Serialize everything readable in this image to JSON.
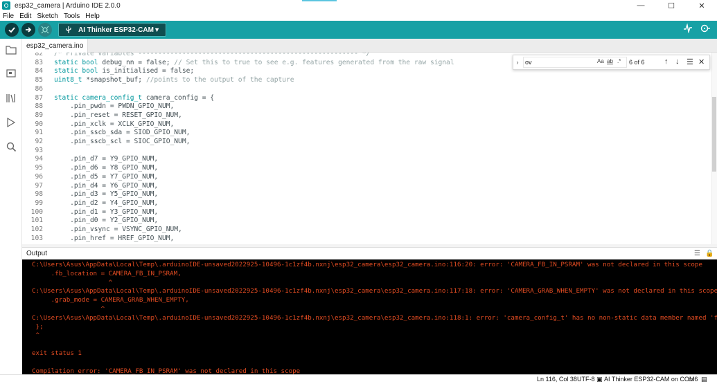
{
  "window": {
    "title": "esp32_camera | Arduino IDE 2.0.0",
    "controls": {
      "minimize": "—",
      "maximize": "☐",
      "close": "✕"
    }
  },
  "menu": [
    "File",
    "Edit",
    "Sketch",
    "Tools",
    "Help"
  ],
  "toolbar": {
    "board_label": "AI Thinker ESP32-CAM"
  },
  "tabs": [
    {
      "label": "esp32_camera.ino"
    }
  ],
  "editor": {
    "lines": [
      {
        "n": "82",
        "parts": [
          {
            "t": "/* Private variables ------------------------------------------------------- */",
            "c": "cm"
          }
        ]
      },
      {
        "n": "83",
        "parts": [
          {
            "t": "static bool",
            "c": "kw"
          },
          {
            "t": " debug_nn = false; ",
            "c": ""
          },
          {
            "t": "// Set this to true to see e.g. features generated from the raw signal",
            "c": "cm"
          }
        ]
      },
      {
        "n": "84",
        "parts": [
          {
            "t": "static bool",
            "c": "kw"
          },
          {
            "t": " is_initialised = false;",
            "c": ""
          }
        ]
      },
      {
        "n": "85",
        "parts": [
          {
            "t": "uint8_t",
            "c": "kw"
          },
          {
            "t": " *snapshot_buf; ",
            "c": ""
          },
          {
            "t": "//points to the output of the capture",
            "c": "cm"
          }
        ]
      },
      {
        "n": "86",
        "parts": []
      },
      {
        "n": "87",
        "parts": [
          {
            "t": "static camera_config_t",
            "c": "kw"
          },
          {
            "t": " camera_config = {",
            "c": ""
          }
        ]
      },
      {
        "n": "88",
        "parts": [
          {
            "t": "    .pin_pwdn = PWDN_GPIO_NUM,",
            "c": ""
          }
        ]
      },
      {
        "n": "89",
        "parts": [
          {
            "t": "    .pin_reset = RESET_GPIO_NUM,",
            "c": ""
          }
        ]
      },
      {
        "n": "90",
        "parts": [
          {
            "t": "    .pin_xclk = XCLK_GPIO_NUM,",
            "c": ""
          }
        ]
      },
      {
        "n": "91",
        "parts": [
          {
            "t": "    .pin_sscb_sda = SIOD_GPIO_NUM,",
            "c": ""
          }
        ]
      },
      {
        "n": "92",
        "parts": [
          {
            "t": "    .pin_sscb_scl = SIOC_GPIO_NUM,",
            "c": ""
          }
        ]
      },
      {
        "n": "93",
        "parts": []
      },
      {
        "n": "94",
        "parts": [
          {
            "t": "    .pin_d7 = Y9_GPIO_NUM,",
            "c": ""
          }
        ]
      },
      {
        "n": "95",
        "parts": [
          {
            "t": "    .pin_d6 = Y8_GPIO_NUM,",
            "c": ""
          }
        ]
      },
      {
        "n": "96",
        "parts": [
          {
            "t": "    .pin_d5 = Y7_GPIO_NUM,",
            "c": ""
          }
        ]
      },
      {
        "n": "97",
        "parts": [
          {
            "t": "    .pin_d4 = Y6_GPIO_NUM,",
            "c": ""
          }
        ]
      },
      {
        "n": "98",
        "parts": [
          {
            "t": "    .pin_d3 = Y5_GPIO_NUM,",
            "c": ""
          }
        ]
      },
      {
        "n": "99",
        "parts": [
          {
            "t": "    .pin_d2 = Y4_GPIO_NUM,",
            "c": ""
          }
        ]
      },
      {
        "n": "100",
        "parts": [
          {
            "t": "    .pin_d1 = Y3_GPIO_NUM,",
            "c": ""
          }
        ]
      },
      {
        "n": "101",
        "parts": [
          {
            "t": "    .pin_d0 = Y2_GPIO_NUM,",
            "c": ""
          }
        ]
      },
      {
        "n": "102",
        "parts": [
          {
            "t": "    .pin_vsync = VSYNC_GPIO_NUM,",
            "c": ""
          }
        ]
      },
      {
        "n": "103",
        "parts": [
          {
            "t": "    .pin_href = HREF_GPIO_NUM,",
            "c": ""
          }
        ]
      }
    ]
  },
  "find": {
    "query": "ov",
    "match_case": "Aa",
    "whole_word": "ab",
    "regex": ".*",
    "count": "6 of 6"
  },
  "output": {
    "title": "Output",
    "lines": [
      {
        "t": "C:\\Users\\Asus\\AppData\\Local\\Temp\\.arduinoIDE-unsaved2022925-10496-1c1zf4b.nxnj\\esp32_camera\\esp32_camera.ino:116:20: error: 'CAMERA_FB_IN_PSRAM' was not declared in this scope",
        "c": "err"
      },
      {
        "t": "     .fb_location = CAMERA_FB_IN_PSRAM,",
        "c": "err"
      },
      {
        "t": "                    ^",
        "c": "err"
      },
      {
        "t": "C:\\Users\\Asus\\AppData\\Local\\Temp\\.arduinoIDE-unsaved2022925-10496-1c1zf4b.nxnj\\esp32_camera\\esp32_camera.ino:117:18: error: 'CAMERA_GRAB_WHEN_EMPTY' was not declared in this scope",
        "c": "err"
      },
      {
        "t": "     .grab_mode = CAMERA_GRAB_WHEN_EMPTY,",
        "c": "err"
      },
      {
        "t": "                  ^",
        "c": "err"
      },
      {
        "t": "C:\\Users\\Asus\\AppData\\Local\\Temp\\.arduinoIDE-unsaved2022925-10496-1c1zf4b.nxnj\\esp32_camera\\esp32_camera.ino:118:1: error: 'camera_config_t' has no non-static data member named 'fb_location'",
        "c": "err"
      },
      {
        "t": " };",
        "c": "err"
      },
      {
        "t": " ^",
        "c": "err"
      },
      {
        "t": "",
        "c": "err"
      },
      {
        "t": "exit status 1",
        "c": "err"
      },
      {
        "t": "",
        "c": "err"
      },
      {
        "t": "Compilation error: 'CAMERA_FB_IN_PSRAM' was not declared in this scope",
        "c": "err"
      }
    ]
  },
  "statusbar": {
    "cursor": "Ln 116, Col 38",
    "encoding": "UTF-8",
    "board_port": "AI Thinker ESP32-CAM on COM6"
  },
  "colors": {
    "toolbar": "#17a1a5",
    "error": "#e34c22",
    "keyword": "#00979d"
  }
}
